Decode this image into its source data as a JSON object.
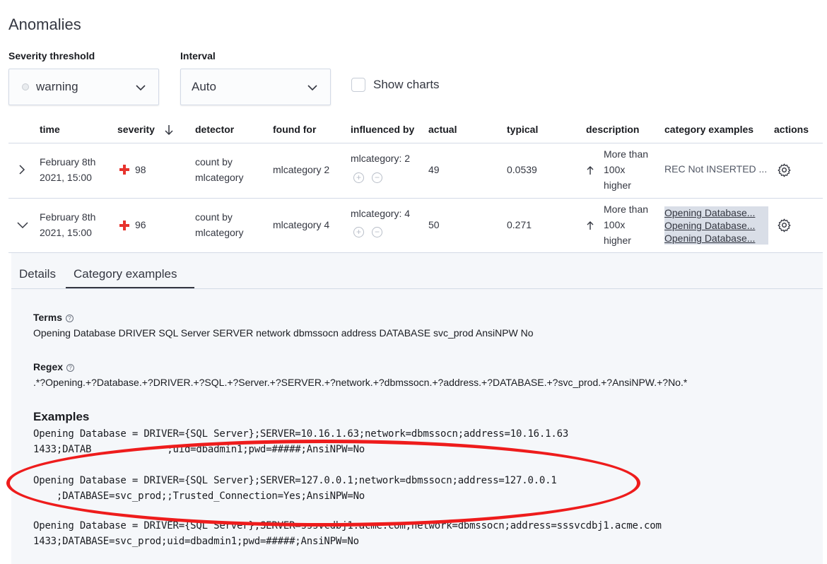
{
  "title": "Anomalies",
  "filters": {
    "severity_label": "Severity threshold",
    "severity_value": "warning",
    "interval_label": "Interval",
    "interval_value": "Auto",
    "show_charts_label": "Show charts"
  },
  "table": {
    "headers": [
      "time",
      "severity",
      "detector",
      "found for",
      "influenced by",
      "actual",
      "typical",
      "description",
      "category examples",
      "actions"
    ],
    "rows": [
      {
        "time_line1": "February 8th",
        "time_line2": "2021, 15:00",
        "severity": "98",
        "detector_line1": "count by",
        "detector_line2": "mlcategory",
        "found_for": "mlcategory 2",
        "influenced_by": "mlcategory: 2",
        "actual": "49",
        "typical": "0.0539",
        "description_line1": "More than",
        "description_line2": "100x",
        "description_line3": "higher",
        "category_examples": [
          "REC Not INSERTED ..."
        ]
      },
      {
        "time_line1": "February 8th",
        "time_line2": "2021, 15:00",
        "severity": "96",
        "detector_line1": "count by",
        "detector_line2": "mlcategory",
        "found_for": "mlcategory 4",
        "influenced_by": "mlcategory: 4",
        "actual": "50",
        "typical": "0.271",
        "description_line1": "More than",
        "description_line2": "100x",
        "description_line3": "higher",
        "category_examples": [
          "Opening Database...",
          "Opening Database...",
          "Opening Database..."
        ]
      }
    ]
  },
  "details": {
    "tabs": [
      "Details",
      "Category examples"
    ],
    "terms_label": "Terms",
    "terms_value": "Opening Database DRIVER SQL Server SERVER network dbmssocn address DATABASE svc_prod AnsiNPW No",
    "regex_label": "Regex",
    "regex_value": ".*?Opening.+?Database.+?DRIVER.+?SQL.+?Server.+?SERVER.+?network.+?dbmssocn.+?address.+?DATABASE.+?svc_prod.+?AnsiNPW.+?No.*",
    "examples_label": "Examples",
    "examples": [
      {
        "line1": "Opening Database = DRIVER={SQL Server};SERVER=10.16.1.63;network=dbmssocn;address=10.16.1.63",
        "line2": "1433;DATAB             ;uid=dbadmin1;pwd=#####;AnsiNPW=No"
      },
      {
        "line1": "Opening Database = DRIVER={SQL Server};SERVER=127.0.0.1;network=dbmssocn;address=127.0.0.1",
        "line2": "    ;DATABASE=svc_prod;;Trusted_Connection=Yes;AnsiNPW=No"
      },
      {
        "line1": "Opening Database = DRIVER={SQL Server};SERVER=sssvcdbj1.acme.com;network=dbmssocn;address=sssvcdbj1.acme.com",
        "line2": "1433;DATABASE=svc_prod;uid=dbadmin1;pwd=#####;AnsiNPW=No"
      }
    ]
  },
  "colors": {
    "severity_critical": "#e7332d",
    "annotation": "#ee1c1c"
  }
}
